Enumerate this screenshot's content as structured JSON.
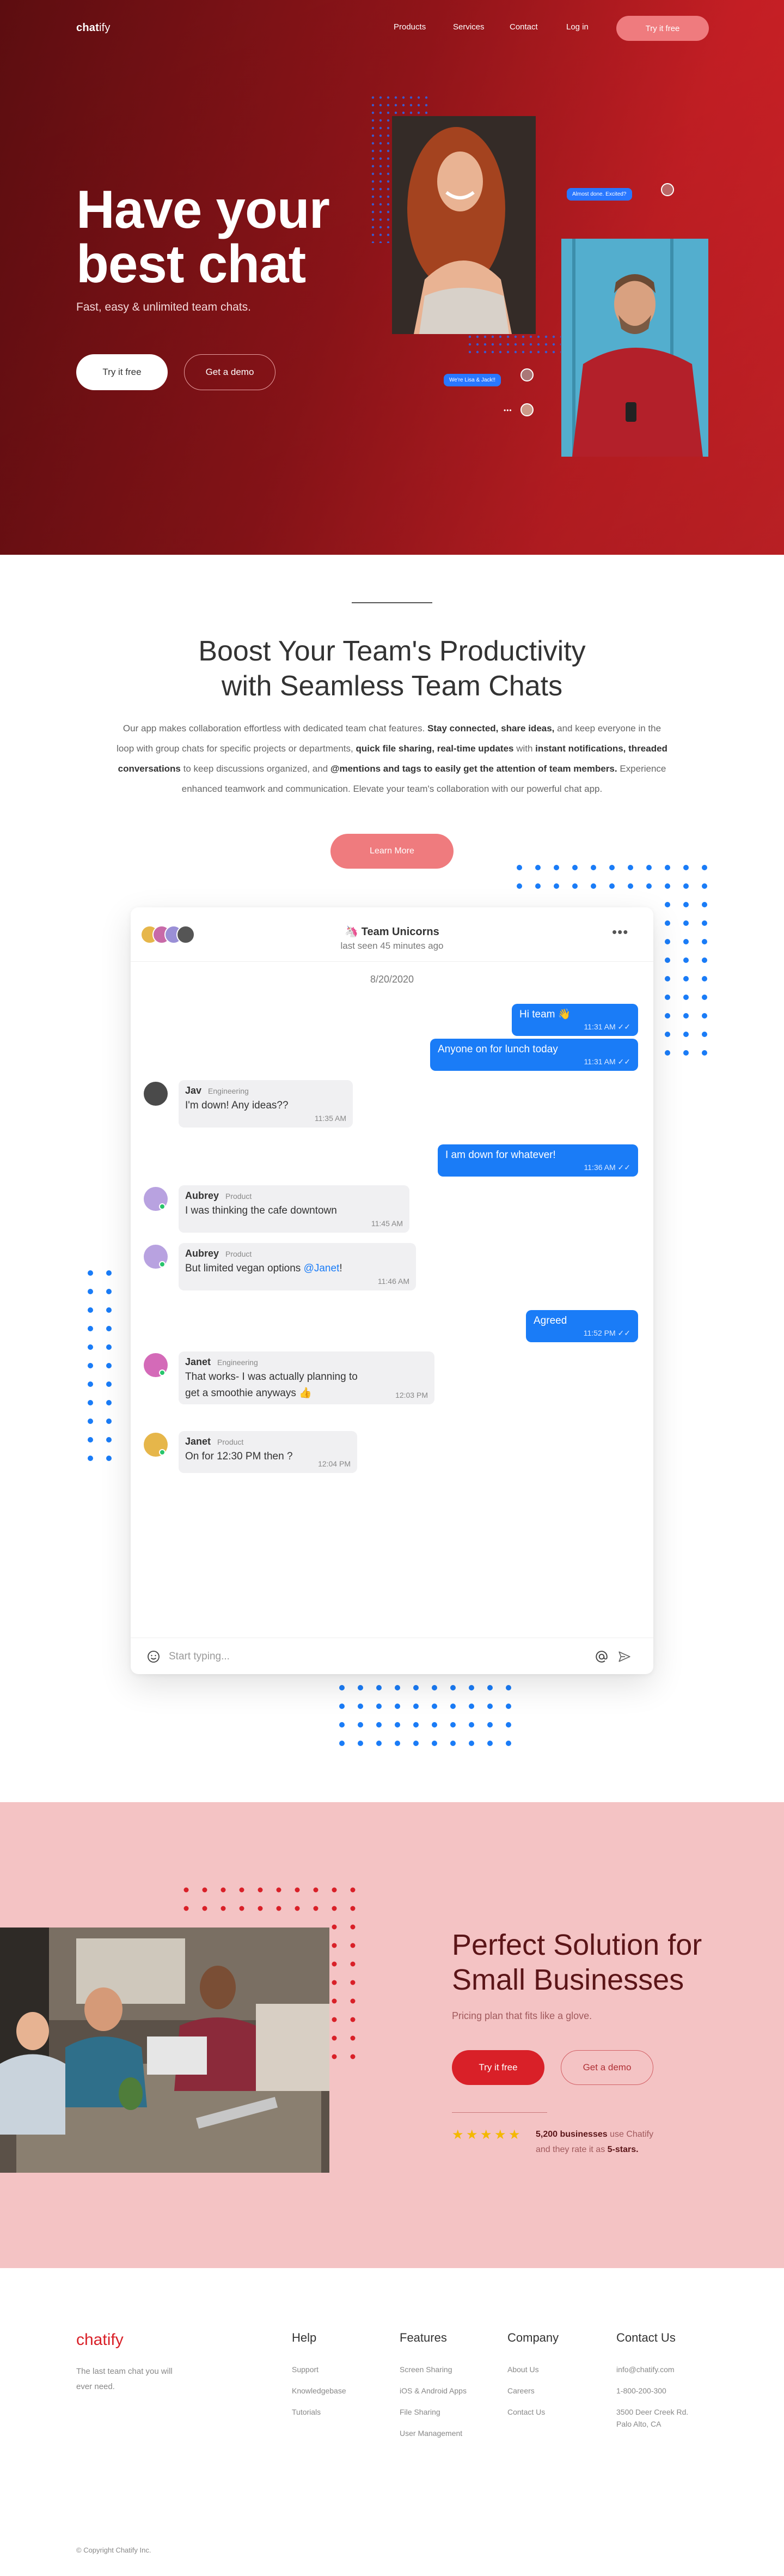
{
  "nav": {
    "logo_a": "chat",
    "logo_b": "ify",
    "links": [
      "Products",
      "Services",
      "Contact",
      "Log in"
    ],
    "cta": "Try it free"
  },
  "hero": {
    "title": "Have your best chat",
    "subtitle": "Fast, easy & unlimited team chats.",
    "primary_button": "Try it free",
    "secondary_button": "Get a demo",
    "bubble_1": "Almost done. Excited?",
    "bubble_2": "We're Lisa & Jack!!"
  },
  "productivity": {
    "title_line1": "Boost Your Team's Productivity",
    "title_line2": "with Seamless Team Chats",
    "text": [
      {
        "t": "Our app makes collaboration effortless with dedicated team chat features. ",
        "b": false
      },
      {
        "t": "Stay connected, share ideas,",
        "b": true
      },
      {
        "t": " and keep everyone in the loop with group chats for specific projects or departments, ",
        "b": false
      },
      {
        "t": "quick file sharing, real-time updates",
        "b": true
      },
      {
        "t": " with ",
        "b": false
      },
      {
        "t": "instant notifications, threaded conversations",
        "b": true
      },
      {
        "t": " to keep discussions organized, and ",
        "b": false
      },
      {
        "t": "@mentions and tags to easily get the attention of team members.",
        "b": true
      },
      {
        "t": " Experience enhanced teamwork and communication. Elevate your team's collaboration with our powerful chat app.",
        "b": false
      }
    ],
    "button": "Learn More"
  },
  "chat": {
    "group_emoji": "🦄",
    "group_name": "Team Unicorns",
    "last_seen": "last seen 45 minutes ago",
    "more": "•••",
    "date": "8/20/2020",
    "messages": [
      {
        "dir": "out",
        "text": "Hi team 👋",
        "time": "11:31 AM"
      },
      {
        "dir": "out",
        "text": "Anyone on for lunch today",
        "time": "11:31 AM"
      },
      {
        "dir": "in",
        "name": "Jav",
        "role": "Engineering",
        "text": "I'm down! Any ideas??",
        "time": "11:35 AM"
      },
      {
        "dir": "out",
        "text": "I am down for whatever!",
        "time": "11:36 AM"
      },
      {
        "dir": "in",
        "name": "Aubrey",
        "role": "Product",
        "text": "I was thinking the cafe downtown",
        "time": "11:45 AM"
      },
      {
        "dir": "in",
        "name": "Aubrey",
        "role": "Product",
        "text_before": "But limited vegan options ",
        "mention": "@Janet",
        "text_after": "!",
        "time": "11:46 AM"
      },
      {
        "dir": "out",
        "text": "Agreed",
        "time": "11:52 PM"
      },
      {
        "dir": "in",
        "name": "Janet",
        "role": "Engineering",
        "text_line1": "That works- I was actually planning to",
        "text_line2": "get a smoothie anyways 👍",
        "time": "12:03 PM"
      },
      {
        "dir": "in",
        "name": "Janet",
        "role": "Product",
        "text": "On for 12:30 PM then ?",
        "time": "12:04 PM"
      }
    ],
    "input_placeholder": "Start typing...",
    "checkmarks": "✓✓"
  },
  "small_business": {
    "title_line1": "Perfect Solution for",
    "title_line2": "Small Businesses",
    "subtitle": "Pricing plan that fits like a glove.",
    "primary_button": "Try it free",
    "secondary_button": "Get a demo",
    "rating": 5,
    "rating_bold": "5,200 businesses",
    "rating_mid": " use Chatify",
    "rating_line2": "and they rate it as ",
    "rating_score": "5-stars."
  },
  "footer": {
    "logo_a": "chat",
    "logo_b": "ify",
    "tagline": "The last team chat you will ever need.",
    "columns": [
      {
        "title": "Help",
        "links": [
          "Support",
          "Knowledgebase",
          "Tutorials"
        ]
      },
      {
        "title": "Features",
        "links": [
          "Screen Sharing",
          "iOS & Android Apps",
          "File Sharing",
          "User Management"
        ]
      },
      {
        "title": "Company",
        "links": [
          "About Us",
          "Careers",
          "Contact Us"
        ]
      },
      {
        "title": "Contact Us",
        "links": [
          "info@chatify.com",
          "1-800-200-300",
          "3500 Deer Creek Rd.",
          "Palo Alto, CA"
        ]
      }
    ],
    "copyright": "© Copyright Chatify Inc."
  },
  "colors": {
    "brand_red": "#d92028",
    "accent_blue": "#1a7cf7",
    "pink_bg": "#f4c3c4",
    "star": "#f4b800"
  }
}
